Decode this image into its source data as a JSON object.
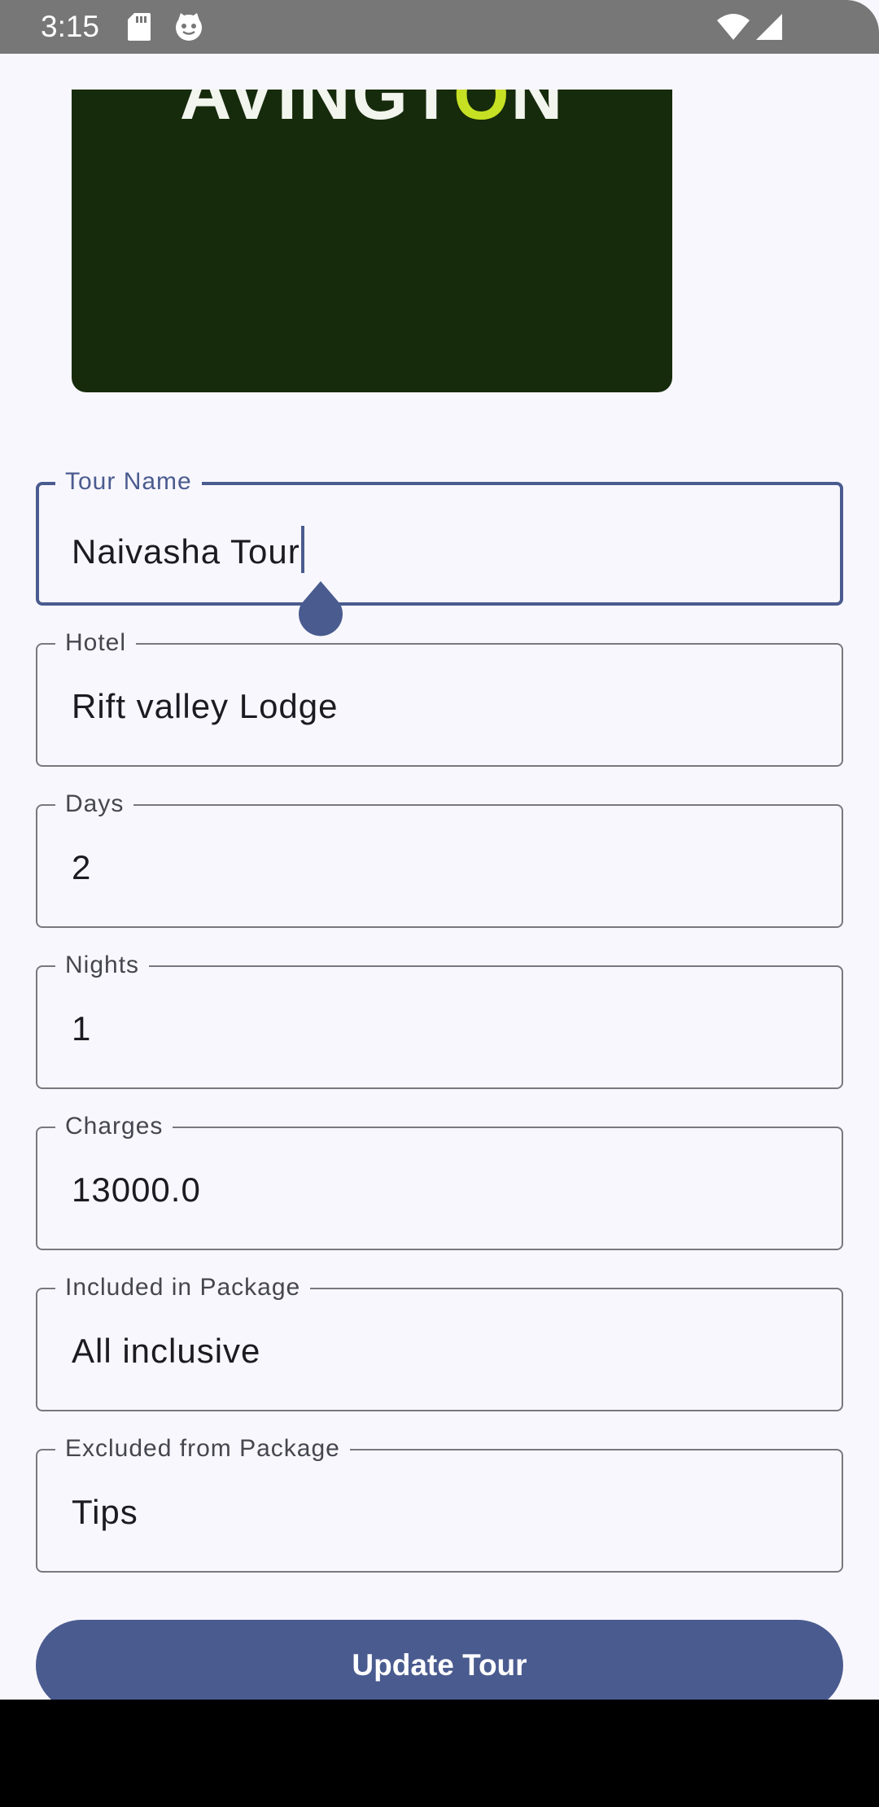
{
  "status_bar": {
    "time": "3:15",
    "icons": [
      "sd-card-icon",
      "cat-face-icon",
      "wifi-icon",
      "cell-signal-icon"
    ]
  },
  "banner": {
    "logo_text_start": "AVINGT",
    "logo_text_accent": "O",
    "logo_text_end": "N"
  },
  "form": {
    "tour_name": {
      "label": "Tour Name",
      "value": "Naivasha Tour"
    },
    "hotel": {
      "label": "Hotel",
      "value": "Rift valley Lodge"
    },
    "days": {
      "label": "Days",
      "value": "2"
    },
    "nights": {
      "label": "Nights",
      "value": "1"
    },
    "charges": {
      "label": "Charges",
      "value": "13000.0"
    },
    "included": {
      "label": "Included in Package",
      "value": "All inclusive"
    },
    "excluded": {
      "label": "Excluded from Package",
      "value": "Tips"
    }
  },
  "actions": {
    "update_label": "Update Tour"
  },
  "colors": {
    "primary": "#4a5b8f",
    "background": "#f8f7fd",
    "banner_bg": "#162b0b",
    "logo_accent": "#c6e024",
    "status_bar": "#777777"
  }
}
